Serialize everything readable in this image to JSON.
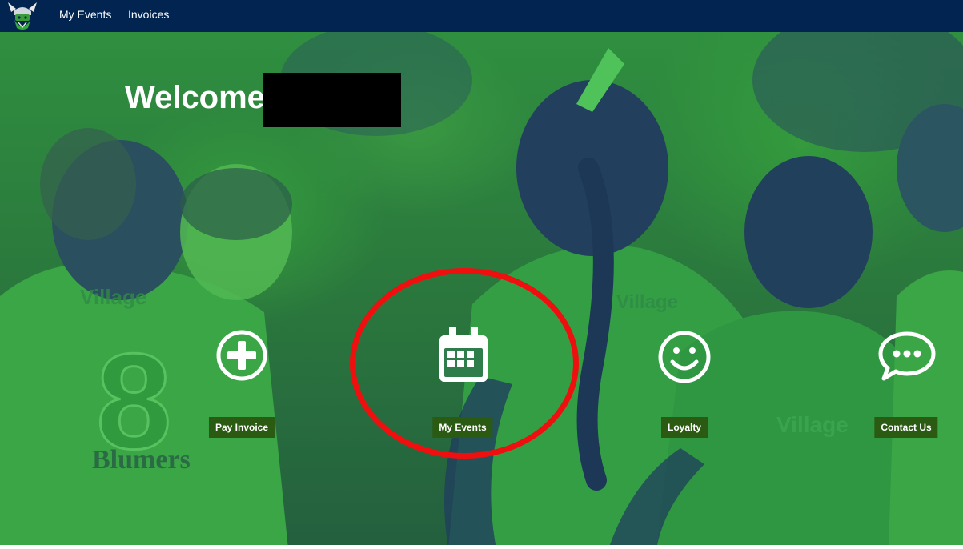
{
  "nav": {
    "logo_icon": "raiders-viking-logo-icon",
    "links": [
      {
        "label": "My Events"
      },
      {
        "label": "Invoices"
      }
    ]
  },
  "hero": {
    "welcome_text": "Welcome",
    "redacted_name": ""
  },
  "actions": [
    {
      "label": "Pay Invoice",
      "icon": "plus-circle-icon"
    },
    {
      "label": "My Events",
      "icon": "calendar-icon",
      "highlighted": true
    },
    {
      "label": "Loyalty",
      "icon": "smiley-icon"
    },
    {
      "label": "Contact Us",
      "icon": "speech-bubble-icon"
    }
  ],
  "colors": {
    "navbar": "#022451",
    "hero_green": "#2f8f3f",
    "hero_navy": "#203a63",
    "label_bg": "#2b5a12",
    "highlight_ring": "#ef0f0f"
  }
}
